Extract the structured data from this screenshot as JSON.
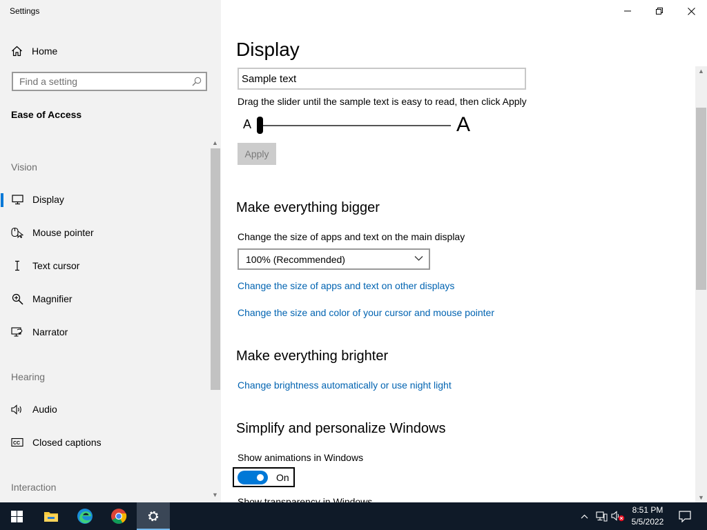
{
  "window": {
    "title": "Settings"
  },
  "sidebar": {
    "home_label": "Home",
    "search_placeholder": "Find a setting",
    "section_title": "Ease of Access",
    "groups": [
      {
        "label": "Vision"
      },
      {
        "label": "Hearing"
      },
      {
        "label": "Interaction"
      }
    ],
    "items": [
      {
        "label": "Display",
        "icon": "monitor-icon",
        "active": true
      },
      {
        "label": "Mouse pointer",
        "icon": "mouse-pointer-icon"
      },
      {
        "label": "Text cursor",
        "icon": "text-cursor-icon"
      },
      {
        "label": "Magnifier",
        "icon": "magnifier-icon"
      },
      {
        "label": "Narrator",
        "icon": "narrator-icon"
      },
      {
        "label": "Audio",
        "icon": "speaker-icon"
      },
      {
        "label": "Closed captions",
        "icon": "closed-captions-icon"
      }
    ]
  },
  "main": {
    "title": "Display",
    "sample_text_value": "Sample text",
    "slider_hint": "Drag the slider until the sample text is easy to read, then click Apply",
    "slider_small_label": "A",
    "slider_large_label": "A",
    "slider_level": 0,
    "apply_label": "Apply",
    "bigger": {
      "heading": "Make everything bigger",
      "label": "Change the size of apps and text on the main display",
      "dropdown_value": "100% (Recommended)",
      "link1": "Change the size of apps and text on other displays",
      "link2": "Change the size and color of your cursor and mouse pointer"
    },
    "brighter": {
      "heading": "Make everything brighter",
      "link": "Change brightness automatically or use night light"
    },
    "simplify": {
      "heading": "Simplify and personalize Windows",
      "animations_label": "Show animations in Windows",
      "animations_state": "On",
      "transparency_label": "Show transparency in Windows"
    }
  },
  "taskbar": {
    "time": "8:51 PM",
    "date": "5/5/2022",
    "apps": [
      "start-icon",
      "file-explorer-icon",
      "edge-icon",
      "chrome-icon",
      "settings-icon"
    ]
  },
  "colors": {
    "accent": "#0078d7",
    "link": "#0063b1",
    "sidebar_bg": "#f2f2f2",
    "taskbar_bg": "#0f1a28"
  }
}
